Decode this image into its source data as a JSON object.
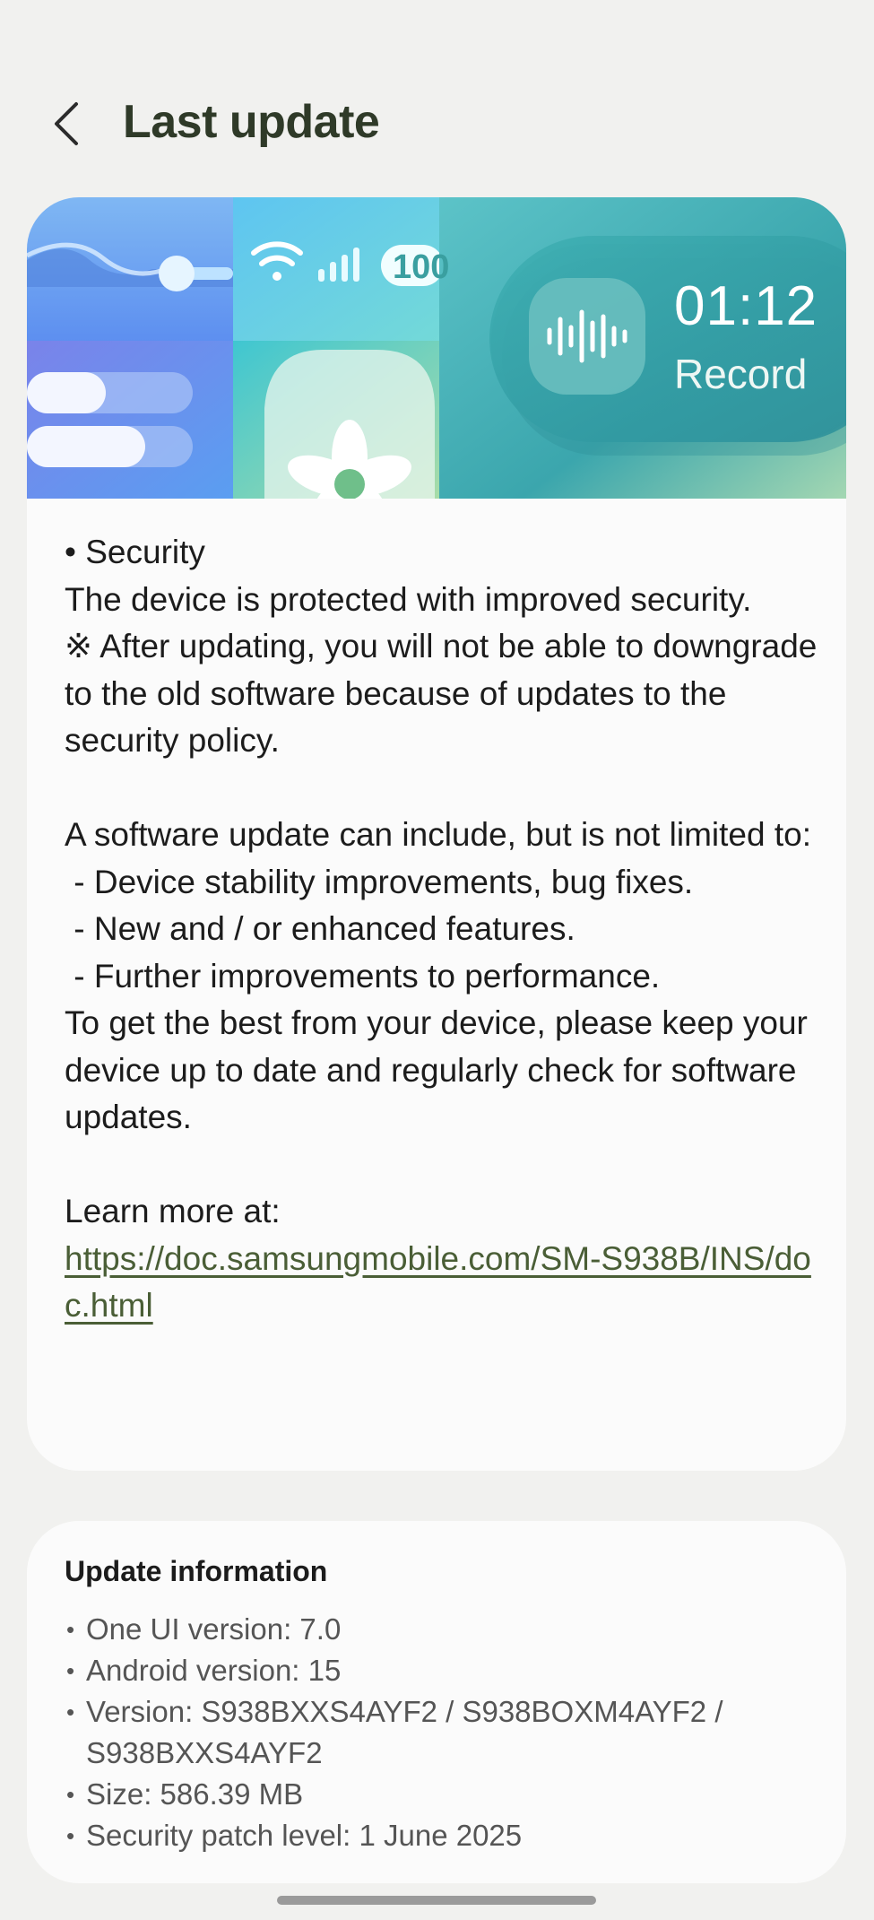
{
  "header": {
    "title": "Last update"
  },
  "banner": {
    "battery_text": "100",
    "time": "01:12",
    "record_label": "Record"
  },
  "notes": {
    "security_heading": "• Security",
    "security_body": "The device is protected with improved security.",
    "security_note": "※ After updating, you will not be able to downgrade to the old software because of updates to the security policy.",
    "intro": "A software update can include, but is not limited to:",
    "items": [
      " - Device stability improvements, bug fixes.",
      " - New and / or enhanced features.",
      " - Further improvements to performance."
    ],
    "closing": "To get the best from your device, please keep your device up to date and regularly check for software updates.",
    "learn_more": "Learn more at:",
    "link": "https://doc.samsungmobile.com/SM-S938B/INS/doc.html"
  },
  "info": {
    "title": "Update information",
    "items": [
      "One UI version: 7.0",
      "Android version: 15",
      "Version: S938BXXS4AYF2 / S938BOXM4AYF2 / S938BXXS4AYF2",
      "Size: 586.39 MB",
      "Security patch level: 1 June 2025"
    ]
  },
  "colors": {
    "background": "#f1f1ef",
    "card": "#fbfbfb",
    "title": "#2f3a28",
    "link": "#4a5e36"
  }
}
